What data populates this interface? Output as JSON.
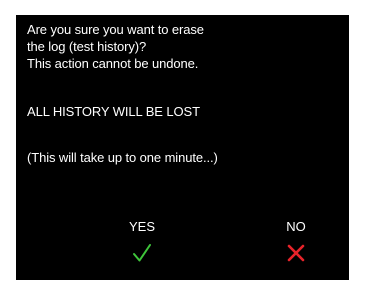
{
  "dialog": {
    "message_lines": [
      "Are you sure you want to erase",
      "the log (test history)?",
      "This action cannot be undone."
    ],
    "warning": "ALL HISTORY WILL BE LOST",
    "note": "(This will take up to one minute...)"
  },
  "buttons": {
    "yes_label": "YES",
    "no_label": "NO",
    "yes_icon": "check-icon",
    "no_icon": "x-icon",
    "yes_color": "#3ec43a",
    "no_color": "#e8232a"
  },
  "colors": {
    "screen_background": "#000000",
    "text": "#ffffff"
  }
}
